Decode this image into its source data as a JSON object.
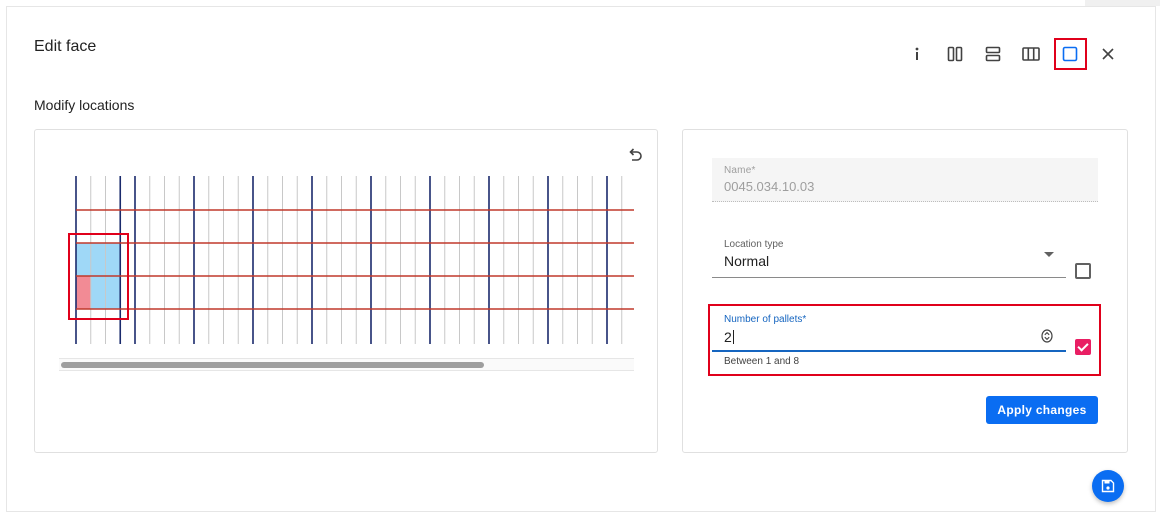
{
  "dialog": {
    "title": "Edit face",
    "toolbar": {
      "icons": [
        "info-icon",
        "two-columns-icon",
        "two-rows-icon",
        "three-columns-icon",
        "single-frame-icon",
        "close-icon"
      ],
      "selected": "single-frame-icon"
    }
  },
  "section": {
    "title": "Modify locations"
  },
  "grid": {
    "columns": 38,
    "major_column_every": 4,
    "rows": 4,
    "selected_columns": 3,
    "colors": {
      "major_line": "#1a2a6c",
      "minor_line": "#c8c8c8",
      "shelf": "#c0392b",
      "cell_blue": "#9fd8f7",
      "cell_red": "#f28b95"
    },
    "scroll_fraction": 0.74
  },
  "form": {
    "name": {
      "label": "Name*",
      "value": "0045.034.10.03"
    },
    "location_type": {
      "label": "Location type",
      "value": "Normal",
      "checked": false
    },
    "pallets": {
      "label": "Number of pallets*",
      "value": "2",
      "hint": "Between 1 and 8",
      "checked": true
    },
    "apply_label": "Apply changes"
  },
  "colors": {
    "accent": "#0a6df2",
    "highlight": "#e0001b",
    "checkbox_checked": "#e91e63"
  }
}
